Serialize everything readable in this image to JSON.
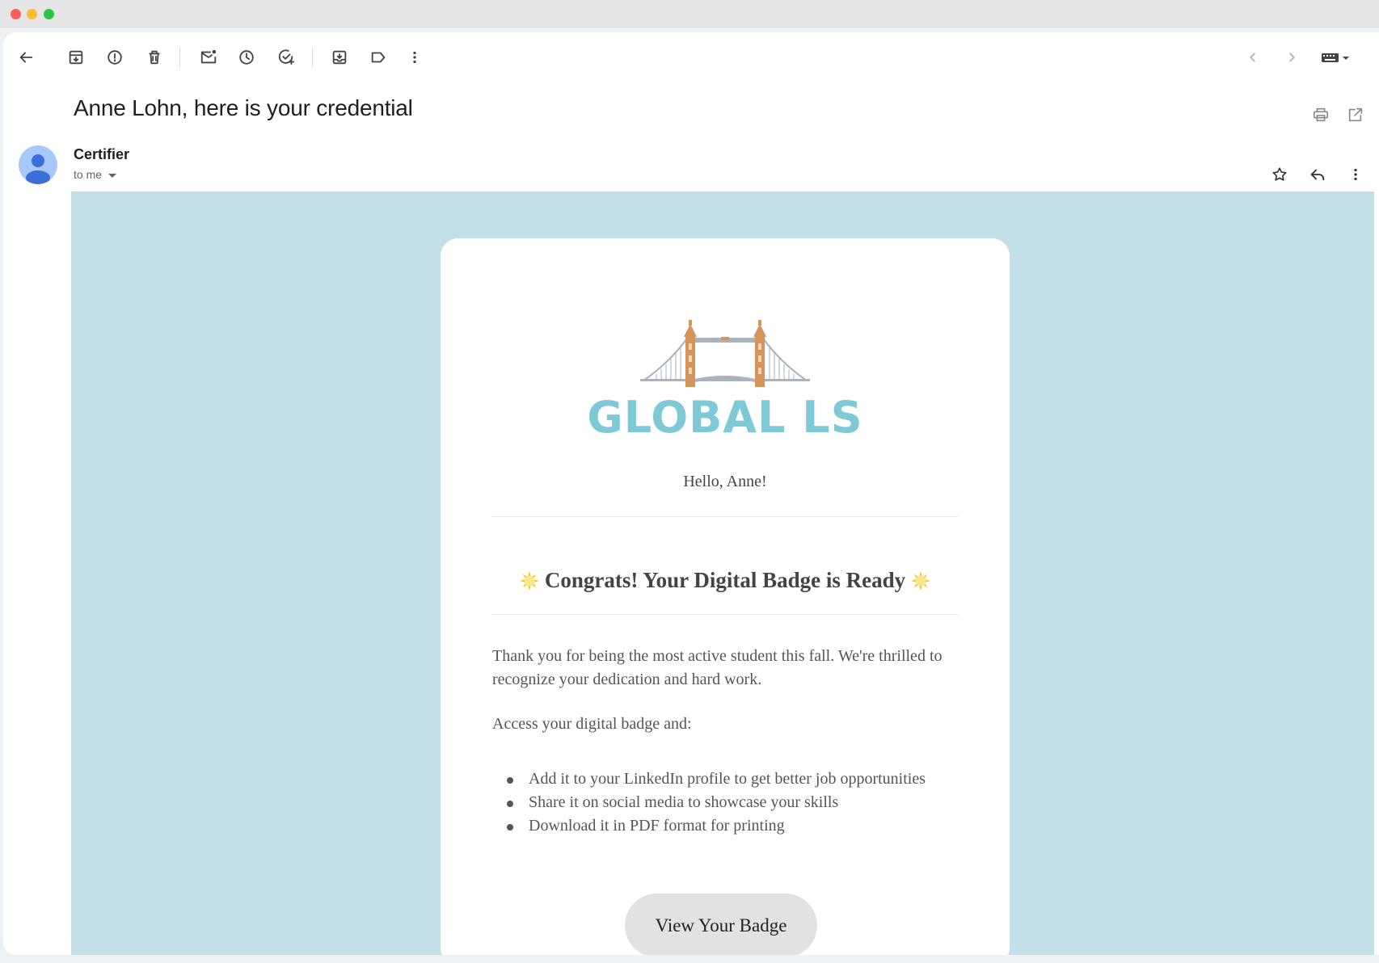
{
  "window": {
    "controls": [
      "close",
      "minimize",
      "maximize"
    ]
  },
  "toolbar": {
    "left_icons": [
      "back-arrow-icon",
      "archive-icon",
      "report-spam-icon",
      "delete-icon",
      "mark-unread-icon",
      "snooze-icon",
      "add-task-icon",
      "move-to-icon",
      "label-icon",
      "more-vert-icon"
    ],
    "right_icons": [
      "chevron-left-icon",
      "chevron-right-icon",
      "keyboard-icon"
    ]
  },
  "email": {
    "subject": "Anne Lohn, here is your credential",
    "sender_name": "Certifier",
    "recipient": "to me",
    "header_icons": [
      "print-icon",
      "open-in-new-window-icon",
      "star-icon",
      "reply-icon",
      "more-vert-icon"
    ]
  },
  "message": {
    "brand": "GLOBAL LS",
    "greeting": "Hello, Anne!",
    "headline": "Congrats! Your Digital Badge is Ready",
    "paragraph_1": "Thank you for being the most active student this fall. We're thrilled to recognize your dedication and hard work.",
    "paragraph_2": "Access your digital badge and:",
    "bullets": [
      "Add it to your LinkedIn profile to get better job opportunities",
      "Share it on social media to showcase your skills",
      "Download it in PDF format for printing"
    ],
    "cta_label": "View Your Badge"
  },
  "colors": {
    "email_background": "#c2e0e6",
    "brand_text": "#7fc8d6",
    "tower": "#d4945a",
    "button": "#e2e2e2"
  }
}
